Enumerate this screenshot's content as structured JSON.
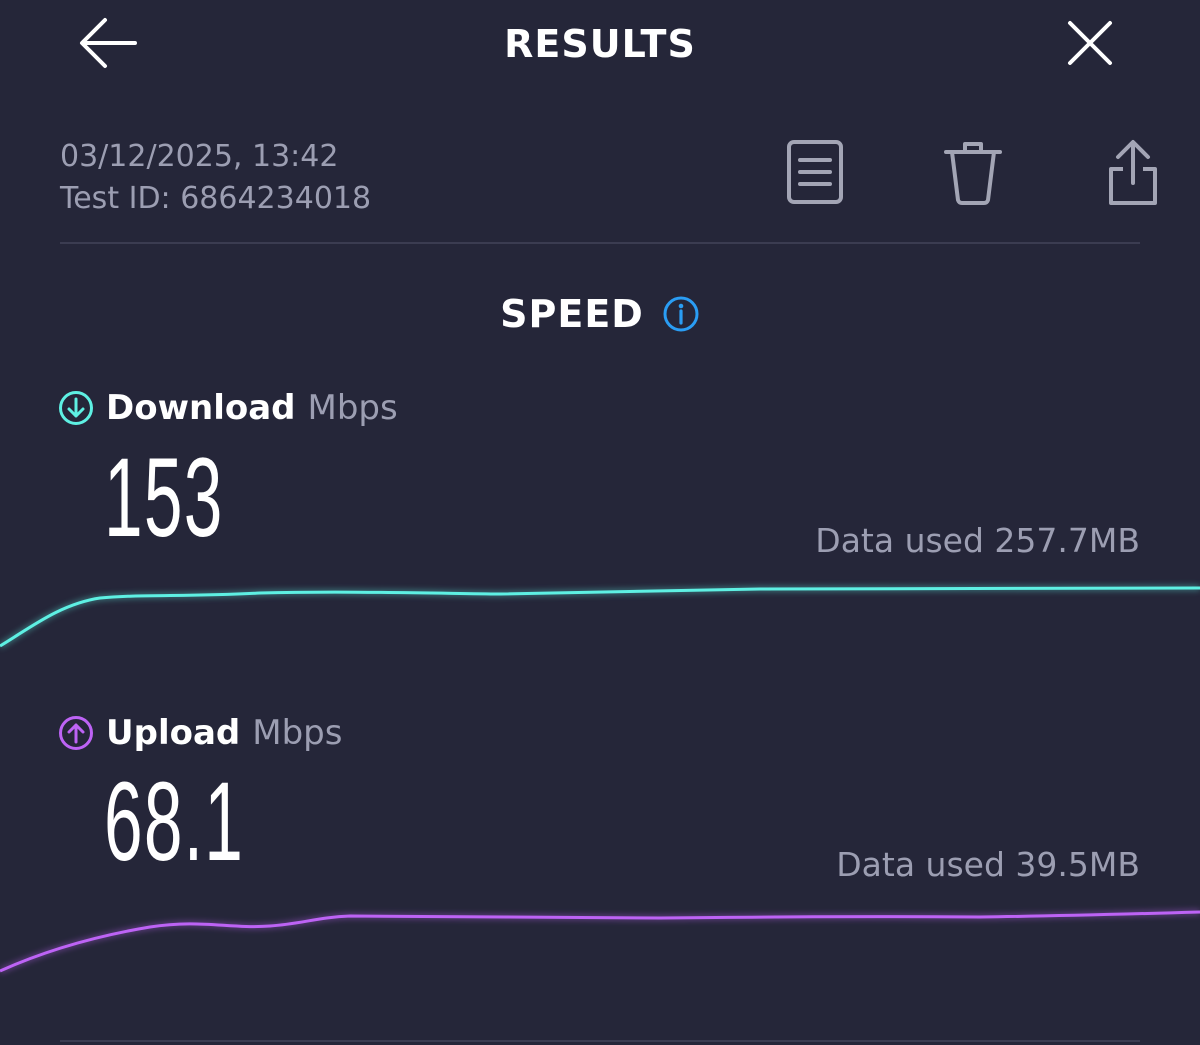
{
  "header": {
    "title": "RESULTS",
    "back_icon": "arrow-left-icon",
    "close_icon": "close-icon"
  },
  "test": {
    "datetime": "03/12/2025, 13:42",
    "test_id": "Test ID: 6864234018"
  },
  "actions": {
    "report_icon": "document-icon",
    "delete_icon": "trash-icon",
    "share_icon": "share-icon"
  },
  "speed": {
    "title": "SPEED",
    "info_icon": "info-icon"
  },
  "download": {
    "label": "Download",
    "unit": "Mbps",
    "value": "153",
    "data_used": "Data used 257.7MB",
    "color": "#5ef0e3",
    "icon": "arrow-down-circle-icon"
  },
  "upload": {
    "label": "Upload",
    "unit": "Mbps",
    "value": "68.1",
    "data_used": "Data used 39.5MB",
    "color": "#bd63f5",
    "icon": "arrow-up-circle-icon"
  },
  "colors": {
    "background": "#252639",
    "secondary_text": "#9c9eb2",
    "accent_blue": "#2a9df4",
    "icon_gray": "#a3a5b5"
  }
}
